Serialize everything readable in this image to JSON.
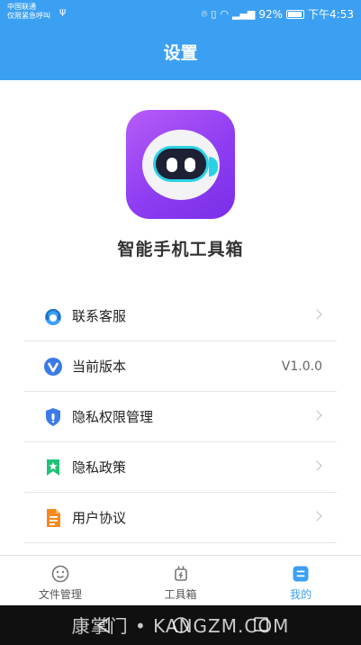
{
  "status_bar": {
    "carrier_line1": "中国联通",
    "carrier_line2": "仅限紧急呼叫",
    "battery_percent": "92%",
    "time": "下午4:53"
  },
  "header": {
    "title": "设置"
  },
  "app": {
    "name": "智能手机工具箱"
  },
  "menu": {
    "items": [
      {
        "label": "联系客服",
        "icon": "headset-icon"
      },
      {
        "label": "当前版本",
        "icon": "version-v-icon",
        "value": "V1.0.0"
      },
      {
        "label": "隐私权限管理",
        "icon": "shield-icon"
      },
      {
        "label": "隐私政策",
        "icon": "bookmark-star-icon"
      },
      {
        "label": "用户协议",
        "icon": "document-icon"
      }
    ]
  },
  "tabbar": {
    "tabs": [
      {
        "label": "文件管理",
        "icon": "face-icon",
        "active": false
      },
      {
        "label": "工具箱",
        "icon": "plug-icon",
        "active": false
      },
      {
        "label": "我的",
        "icon": "profile-icon",
        "active": true
      }
    ]
  },
  "watermark": "康掌门 • KANGZM.COM",
  "colors": {
    "accent": "#3ba0f2",
    "logo_purple": "#8e3df2"
  }
}
